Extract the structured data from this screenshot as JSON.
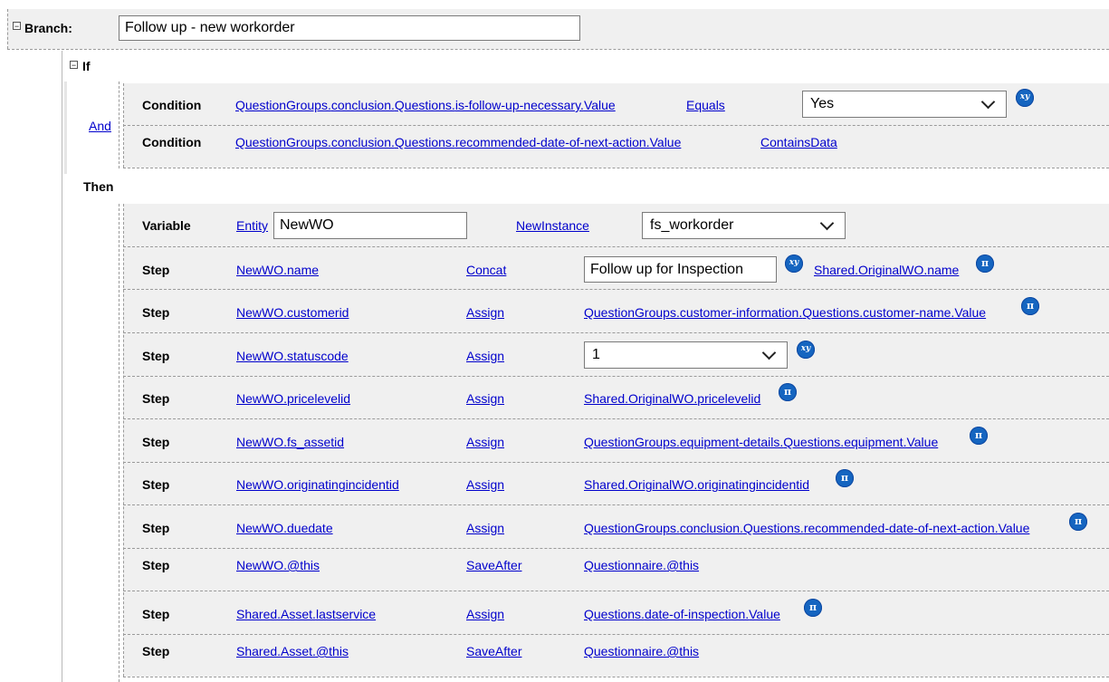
{
  "branch": {
    "label": "Branch:",
    "name_value": "Follow up - new workorder"
  },
  "if_block": {
    "label": "If",
    "and_label": "And",
    "conditions": [
      {
        "label": "Condition",
        "path": [
          "QuestionGroups",
          "conclusion",
          "Questions",
          "is-follow-up-necessary",
          "Value"
        ],
        "operator": "Equals",
        "value": "Yes",
        "icon": "xy-icon"
      },
      {
        "label": "Condition",
        "path": [
          "QuestionGroups",
          "conclusion",
          "Questions",
          "recommended-date-of-next-action",
          "Value"
        ],
        "operator": "ContainsData"
      }
    ]
  },
  "then_block": {
    "label": "Then",
    "variable": {
      "label": "Variable",
      "entity_link": "Entity",
      "entity_value": "NewWO",
      "new_instance_link": "NewInstance",
      "type_value": "fs_workorder"
    },
    "steps": [
      {
        "label": "Step",
        "target": [
          "NewWO",
          "name"
        ],
        "action": "Concat",
        "input": "Follow up for Inspection",
        "source": [
          "Shared",
          "OriginalWO",
          "name"
        ]
      },
      {
        "label": "Step",
        "target": [
          "NewWO",
          "customerid"
        ],
        "action": "Assign",
        "source": [
          "QuestionGroups",
          "customer-information",
          "Questions",
          "customer-name",
          "Value"
        ]
      },
      {
        "label": "Step",
        "target": [
          "NewWO",
          "statuscode"
        ],
        "action": "Assign",
        "select_value": "1"
      },
      {
        "label": "Step",
        "target": [
          "NewWO",
          "pricelevelid"
        ],
        "action": "Assign",
        "source": [
          "Shared",
          "OriginalWO",
          "pricelevelid"
        ]
      },
      {
        "label": "Step",
        "target": [
          "NewWO",
          "fs_assetid"
        ],
        "action": "Assign",
        "source": [
          "QuestionGroups",
          "equipment-details",
          "Questions",
          "equipment",
          "Value"
        ]
      },
      {
        "label": "Step",
        "target": [
          "NewWO",
          "originatingincidentid"
        ],
        "action": "Assign",
        "source": [
          "Shared",
          "OriginalWO",
          "originatingincidentid"
        ]
      },
      {
        "label": "Step",
        "target": [
          "NewWO",
          "duedate"
        ],
        "action": "Assign",
        "source": [
          "QuestionGroups",
          "conclusion",
          "Questions",
          "recommended-date-of-next-action",
          "Value"
        ]
      },
      {
        "label": "Step",
        "target": [
          "NewWO",
          "@this"
        ],
        "action": "SaveAfter",
        "source": [
          "Questionnaire",
          "@this"
        ]
      },
      {
        "label": "Step",
        "target": [
          "Shared",
          "Asset",
          "lastservice"
        ],
        "action": "Assign",
        "source": [
          "Questions",
          "date-of-inspection",
          "Value"
        ]
      },
      {
        "label": "Step",
        "target": [
          "Shared",
          "Asset",
          "@this"
        ],
        "action": "SaveAfter",
        "source": [
          "Questionnaire",
          "@this"
        ]
      }
    ]
  },
  "icons": {
    "pi": "π",
    "xy": "xy",
    "expand": "−"
  },
  "colors": {
    "link": "#0000cc",
    "icon": "#1565c0",
    "band": "#f0f0f0"
  }
}
